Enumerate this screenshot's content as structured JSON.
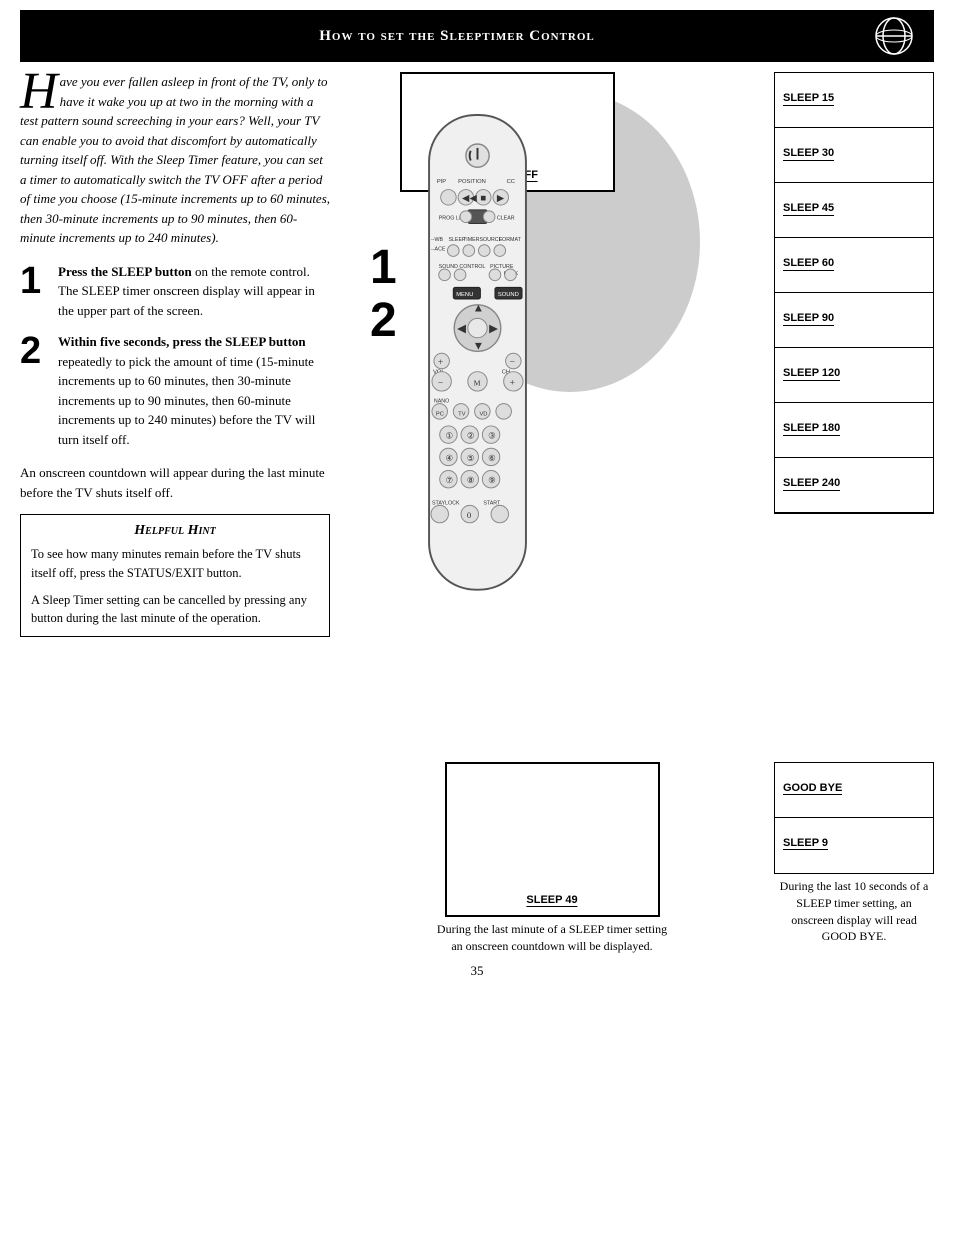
{
  "header": {
    "title": "How to set the Sleeptimer Control"
  },
  "intro": {
    "drop_cap": "H",
    "text": "ave you ever fallen asleep in front of the TV, only to have it wake you up at two in the morning with a test pattern sound screeching in your ears?  Well, your TV can enable you to avoid that discomfort by automatically turning itself off. With the Sleep Timer feature, you can set a timer to automatically switch the TV OFF after a period of time you choose (15-minute increments up to 60 minutes, then 30-minute increments up to 90 minutes, then 60-minute increments up to 240 minutes)."
  },
  "step1": {
    "number": "1",
    "text_bold": "Press the SLEEP button",
    "text_rest": " on the remote control.  The SLEEP timer onscreen display will appear in the upper part of the screen."
  },
  "step2": {
    "number": "2",
    "text_bold": "Within five seconds, press the SLEEP button",
    "text_rest": " repeatedly to pick the amount of time (15-minute increments up to 60 minutes, then 30-minute increments up to 90 minutes, then 60-minute increments up to 240 minutes) before the TV will turn itself off."
  },
  "step_note": "An onscreen countdown will appear during the last minute before the TV shuts itself off.",
  "hint": {
    "title": "Helpful Hint",
    "text1": "To see how many minutes remain before the TV shuts itself off, press the STATUS/EXIT button.",
    "text2": "A Sleep Timer setting can be cancelled by pressing any button during the last minute of the operation."
  },
  "top_screen_label": "SLEEP OFF",
  "sleep_items": [
    "SLEEP 15",
    "SLEEP 30",
    "SLEEP 45",
    "SLEEP 60",
    "SLEEP 90",
    "SLEEP 120",
    "SLEEP 180",
    "SLEEP 240"
  ],
  "bottom_screen_label": "SLEEP 49",
  "bottom_right_items": [
    "GOOD BYE",
    "SLEEP 9"
  ],
  "bottom_caption_left": "During the last minute of a SLEEP timer setting an onscreen countdown will be displayed.",
  "bottom_caption_right": "During the last 10 seconds of a SLEEP timer setting, an onscreen display will read GOOD BYE.",
  "page_number": "35"
}
